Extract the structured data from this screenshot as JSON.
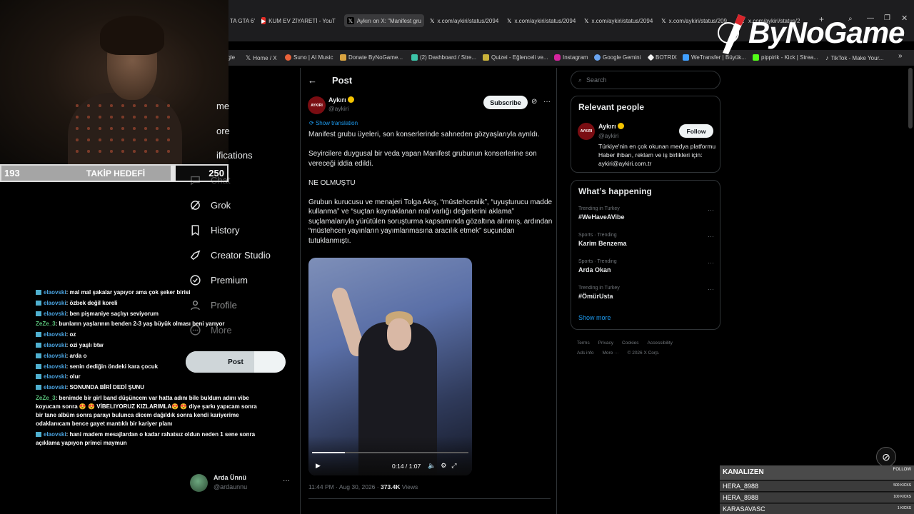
{
  "browser": {
    "tabs": [
      {
        "label": "TA GTA 6'",
        "icon": "tab-icon"
      },
      {
        "label": "KUM EV ZİYARETİ - YouTu",
        "icon": "youtube-icon"
      },
      {
        "label": "Aykırı on X: \"Manifest gru",
        "icon": "x-icon"
      },
      {
        "label": "x.com/aykiri/status/2094",
        "icon": "x-icon"
      },
      {
        "label": "x.com/aykiri/status/2094",
        "icon": "x-icon"
      },
      {
        "label": "x.com/aykiri/status/2094",
        "icon": "x-icon"
      },
      {
        "label": "x.com/aykiri/status/209",
        "icon": "x-icon"
      },
      {
        "label": "x.com/aykiri/status/2",
        "icon": "x-icon"
      }
    ],
    "bookmarks": [
      {
        "label": "ogle",
        "icon": "google-icon"
      },
      {
        "label": "Home / X",
        "icon": "x-icon"
      },
      {
        "label": "Suno | AI Music",
        "icon": "suno-icon"
      },
      {
        "label": "Donate ByNoGame...",
        "icon": "bynogame-icon"
      },
      {
        "label": "(2) Dashboard / Stre...",
        "icon": "dashboard-icon"
      },
      {
        "label": "Quizei - Eğlenceli ve...",
        "icon": "quizei-icon"
      },
      {
        "label": "Instagram",
        "icon": "instagram-icon"
      },
      {
        "label": "Google Gemini",
        "icon": "gemini-icon"
      },
      {
        "label": "BOTRIX",
        "icon": "botrix-icon"
      },
      {
        "label": "WeTransfer | Büyük...",
        "icon": "wetransfer-icon"
      },
      {
        "label": "pippirik - Kick | Strea...",
        "icon": "kick-icon"
      },
      {
        "label": "TikTok - Make Your...",
        "icon": "tiktok-icon"
      }
    ],
    "more_bookmarks": "»"
  },
  "logo": {
    "text": "ByNoGame"
  },
  "takip": {
    "current": "193",
    "label": "TAKİP HEDEFİ",
    "target": "250",
    "progress": 0.772
  },
  "nav": {
    "items": [
      {
        "label": "me",
        "icon": "home-icon"
      },
      {
        "label": "ore",
        "icon": "explore-icon"
      },
      {
        "label": "ifications",
        "icon": "bell-icon"
      },
      {
        "label": "Chat",
        "icon": "chat-icon"
      },
      {
        "label": "Grok",
        "icon": "grok-icon"
      },
      {
        "label": "History",
        "icon": "bookmark-icon"
      },
      {
        "label": "Creator Studio",
        "icon": "rocket-icon"
      },
      {
        "label": "Premium",
        "icon": "premium-icon"
      },
      {
        "label": "Profile",
        "icon": "person-icon"
      },
      {
        "label": "More",
        "icon": "more-icon"
      }
    ],
    "post_button": "Post",
    "account": {
      "name": "Arda Ünnü",
      "handle": "@ardaunnu",
      "menu": "···"
    }
  },
  "chat": [
    {
      "user": "elaovski",
      "msg": ": mal mal şakalar yapıyor ama çok şeker birisi"
    },
    {
      "user": "elaovski",
      "msg": ": özbek değil koreli"
    },
    {
      "user": "elaovski",
      "msg": ": ben pişmaniye saçlıyı seviyorum"
    },
    {
      "user": "ZeZe_3",
      "msg": ": bunların yaşlarının benden 2-3 yaş büyük olması beni yarıyor"
    },
    {
      "user": "elaovski",
      "msg": ": oz"
    },
    {
      "user": "elaovski",
      "msg": ": ozi yaşlı btw"
    },
    {
      "user": "elaovski",
      "msg": ": arda o"
    },
    {
      "user": "elaovski",
      "msg": ": senin dediğin öndeki kara çocuk"
    },
    {
      "user": "elaovski",
      "msg": ": olur"
    },
    {
      "user": "elaovski",
      "msg": ": SONUNDA BİRİ DEDİ ŞUNU"
    },
    {
      "user": "ZeZe_3",
      "msg": ": benimde bir girl band düşüncem var hatta adını bile buldum adını vibe koyucam sonra 😍 😍 VİBELIYORUZ KIZLARIMLA😍 😍 diye şarkı yapıcam sonra bir tane albüm sonra parayı bulunca dicem dağıldık sonra kendi kariyerime odaklanıcam bence gayet mantıklı bir kariyer planı"
    },
    {
      "user": "elaovski",
      "msg": ": hani madem mesajlardan o kadar rahatsız oldun neden 1 sene sonra açıklama yapıyon primci maymun"
    }
  ],
  "post": {
    "header": "Post",
    "back": "←",
    "author": {
      "name": "Aykırı",
      "handle": "@aykiri",
      "avatar_text": "AYKIRI"
    },
    "subscribe": "Subscribe",
    "menu": "···",
    "show_translation": "Show translation",
    "paragraphs": [
      "Manifest grubu üyeleri, son konserlerinde sahneden gözyaşlarıyla ayrıldı.",
      "Seyircilere duygusal bir veda yapan Manifest grubunun konserlerine son vereceği iddia edildi.",
      "NE OLMUŞTU",
      "Grubun kurucusu ve menajeri Tolga Akış, “müstehcenlik”, “uyuşturucu madde kullanma” ve “suçtan kaynaklanan mal varlığı değerlerini aklama” suçlamalarıyla yürütülen soruşturma kapsamında gözaltına alınmış, ardından “müstehcen yayınların yayımlanmasına aracılık etmek” suçundan tutuklanmıştı."
    ],
    "video": {
      "time": "0:14 / 1:07",
      "progress": 0.209
    },
    "timestamp": "11:44 PM · Aug 30, 2026 · ",
    "views": "373.4K",
    "views_label": " Views"
  },
  "sidebar": {
    "search_placeholder": "Search",
    "relevant": {
      "title": "Relevant people",
      "name": "Aykırı",
      "handle": "@aykiri",
      "follow": "Follow",
      "bio": "Türkiye'nin en çok okunan medya platformu Haber ihbarı, reklam ve iş birlikleri için: aykiri@aykiri.com.tr"
    },
    "happening": {
      "title": "What’s happening",
      "trends": [
        {
          "context": "Trending in Turkey",
          "title": "#WeHaveAVibe"
        },
        {
          "context": "Sports · Trending",
          "title": "Karim Benzema"
        },
        {
          "context": "Sports · Trending",
          "title": "Arda Okan"
        },
        {
          "context": "Trending in Turkey",
          "title": "#ÖmürUsta"
        }
      ],
      "show_more": "Show more"
    },
    "footer_line1": [
      "Terms",
      "Privacy",
      "Cookies",
      "Accessibility"
    ],
    "footer_line2": [
      "Ads info",
      "More ···",
      "© 2026 X Corp."
    ]
  },
  "alert": {
    "title": "KANALIZEN",
    "follow": "FOLLOW",
    "rows": [
      {
        "name": "HERA_8988",
        "kicks": "500 KICKS"
      },
      {
        "name": "HERA_8988",
        "kicks": "100 KICKS"
      },
      {
        "name": "KARASAVASC",
        "kicks": "1 KICKS"
      }
    ]
  },
  "colors": {
    "accent": "#1d9bf0",
    "verified": "#f5c400",
    "brand_red": "#7a0d12"
  }
}
